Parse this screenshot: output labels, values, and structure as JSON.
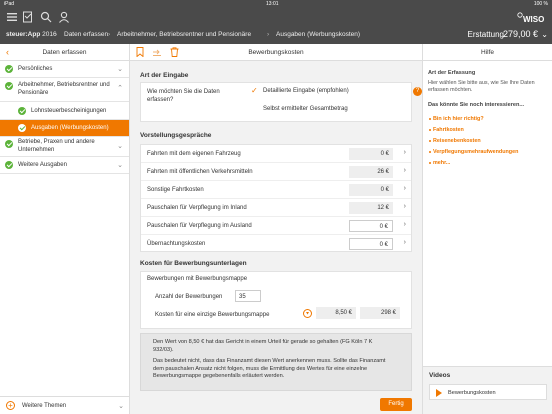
{
  "status": {
    "device": "iPad",
    "time": "13:01",
    "battery": "100 %"
  },
  "app": {
    "name": "steuer:App",
    "year": "2016",
    "brand": "WISO"
  },
  "breadcrumb": [
    "Daten erfassen",
    "Arbeitnehmer, Betriebsrentner und Pensionäre",
    "Ausgaben (Werbungskosten)"
  ],
  "refund": {
    "label": "Erstattung",
    "amount": "279,00 €"
  },
  "sidebar": {
    "title": "Daten erfassen",
    "items": [
      {
        "label": "Persönliches"
      },
      {
        "label": "Arbeitnehmer, Betriebsrentner und Pensionäre"
      },
      {
        "label": "Lohnsteuerbescheinigungen"
      },
      {
        "label": "Ausgaben (Werbungskosten)"
      },
      {
        "label": "Betriebe, Praxen und andere Unternehmen"
      },
      {
        "label": "Weitere Ausgaben"
      }
    ],
    "footer": "Weitere Themen"
  },
  "main": {
    "title": "Bewerbungskosten",
    "art": {
      "heading": "Art der Eingabe",
      "question": "Wie möchten Sie die Daten erfassen?",
      "option1": "Detaillierte Eingabe (empfohlen)",
      "option2": "Selbst ermittelter Gesamtbetrag"
    },
    "vorstellung": {
      "heading": "Vorstellungsgespräche",
      "rows": [
        {
          "label": "Fahrten mit dem eigenen Fahrzeug",
          "value": "0 €"
        },
        {
          "label": "Fahrten mit öffentlichen Verkehrsmitteln",
          "value": "26 €"
        },
        {
          "label": "Sonstige Fahrtkosten",
          "value": "0 €"
        },
        {
          "label": "Pauschalen für Verpflegung im Inland",
          "value": "12 €"
        },
        {
          "label": "Pauschalen für Verpflegung im Ausland",
          "value": "0 €"
        },
        {
          "label": "Übernachtungskosten",
          "value": "0 €"
        }
      ]
    },
    "unterlagen": {
      "heading": "Kosten für Bewerbungsunterlagen",
      "sub": "Bewerbungen mit Bewerbungsmappe",
      "count_label": "Anzahl der Bewerbungen",
      "count_value": "35",
      "cost_label": "Kosten für eine einzige Bewerbungsmappe",
      "cost_value": "8,50 €",
      "total_value": "298 €"
    },
    "notice": {
      "p1": "Den Wert von 8,50 € hat das Gericht in einem Urteil für gerade so gehalten (FG Köln 7 K 932/03).",
      "p2": "Das bedeutet nicht, dass das Finanzamt diesen Wert anerkennen muss. Sollte das Finanzamt dem pauschalen Ansatz nicht folgen, muss die Ermittlung des Wertes für eine einzelne Bewerbungsmappe gegebenenfalls erläutert werden."
    },
    "done_label": "Fertig"
  },
  "help": {
    "title": "Hilfe",
    "h1": "Art der Erfassung",
    "t1": "Hier wählen Sie bitte aus, wie Sie Ihre Daten erfassen möchten.",
    "h2": "Das könnte Sie noch interessieren...",
    "links": [
      "Bin ich hier richtig?",
      "Fahrtkosten",
      "Reisenebenkosten",
      "Verpflegungsmehraufwendungen",
      "mehr..."
    ],
    "videos_title": "Videos",
    "video": "Bewerbungskosten"
  }
}
